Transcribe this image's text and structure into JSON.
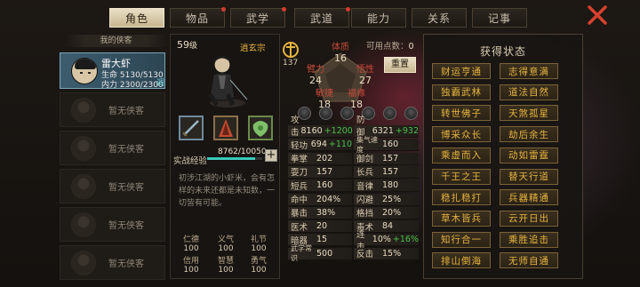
{
  "tabs": [
    {
      "label": "角色",
      "active": true,
      "dot": false
    },
    {
      "label": "物品",
      "dot": true
    },
    {
      "label": "武学",
      "dot": true
    },
    {
      "label": "武道",
      "dot": true
    },
    {
      "label": "能力",
      "dot": false
    },
    {
      "label": "关系",
      "dot": false
    },
    {
      "label": "记事",
      "dot": false
    }
  ],
  "roster": {
    "header": "我的侠客",
    "hero": {
      "name": "雷大虾",
      "hp_label": "生命",
      "hp": "5130/5130",
      "mp_label": "内力",
      "mp": "2300/2300",
      "tag": "调"
    },
    "empty_label": "暂无侠客"
  },
  "profile": {
    "level": "59",
    "level_suffix": "级",
    "sect": "逍玄宗",
    "rank_value": "137",
    "points_label": "可用点数：",
    "points": "0",
    "reset": "重置",
    "exp_label": "实战经验",
    "exp": "8762/10050",
    "exp_fraction": 0.872,
    "bio": "初涉江湖的小虾米，会有怎样的未来还都是未知数，一切皆有可能。",
    "virtues": [
      {
        "name": "仁德",
        "value": "100"
      },
      {
        "name": "义气",
        "value": "100"
      },
      {
        "name": "礼节",
        "value": "100"
      },
      {
        "name": "信用",
        "value": "100"
      },
      {
        "name": "智慧",
        "value": "100"
      },
      {
        "name": "勇气",
        "value": "100"
      }
    ]
  },
  "main_stats": {
    "tizhi": {
      "name": "体质",
      "value": "16"
    },
    "biili": {
      "name": "臂力",
      "value": "24"
    },
    "wuxing": {
      "name": "悟性",
      "value": "27"
    },
    "minjie": {
      "name": "敏捷",
      "value": "18"
    },
    "fuyuan": {
      "name": "福缘",
      "value": "18"
    }
  },
  "stats_left": [
    {
      "k": "攻击力",
      "v": "8160",
      "p": "+1200"
    },
    {
      "k": "轻功",
      "v": "694",
      "p": "+110"
    },
    {
      "k": "拳掌",
      "v": "202",
      "p": ""
    },
    {
      "k": "耍刀",
      "v": "157",
      "p": ""
    },
    {
      "k": "短兵",
      "v": "160",
      "p": ""
    },
    {
      "k": "命中",
      "v": "204%",
      "p": ""
    },
    {
      "k": "暴击",
      "v": "38%",
      "p": ""
    },
    {
      "k": "医术",
      "v": "20",
      "p": ""
    },
    {
      "k": "暗器",
      "v": "15",
      "p": ""
    },
    {
      "k": "武学常识",
      "v": "500",
      "p": ""
    }
  ],
  "stats_right": [
    {
      "k": "防御力",
      "v": "6321",
      "p": "+932"
    },
    {
      "k": "集气速度",
      "v": "160",
      "p": ""
    },
    {
      "k": "御剑",
      "v": "157",
      "p": ""
    },
    {
      "k": "长兵",
      "v": "157",
      "p": ""
    },
    {
      "k": "音律",
      "v": "180",
      "p": ""
    },
    {
      "k": "闪避",
      "v": "25%",
      "p": ""
    },
    {
      "k": "格挡",
      "v": "20%",
      "p": ""
    },
    {
      "k": "毒术",
      "v": "84",
      "p": ""
    },
    {
      "k": "连击",
      "v": "10%",
      "p": "+16%"
    },
    {
      "k": "反击",
      "v": "15%",
      "p": ""
    }
  ],
  "states": {
    "title": "获得状态",
    "items": [
      "财运亨通",
      "志得意满",
      "独霸武林",
      "道法自然",
      "转世佛子",
      "天煞孤星",
      "博采众长",
      "劫后余生",
      "乘虚而入",
      "动如雷霆",
      "千王之王",
      "替天行道",
      "稳扎稳打",
      "兵器精通",
      "草木皆兵",
      "云开日出",
      "知行合一",
      "乘胜追击",
      "排山倒海",
      "无师自通"
    ]
  }
}
